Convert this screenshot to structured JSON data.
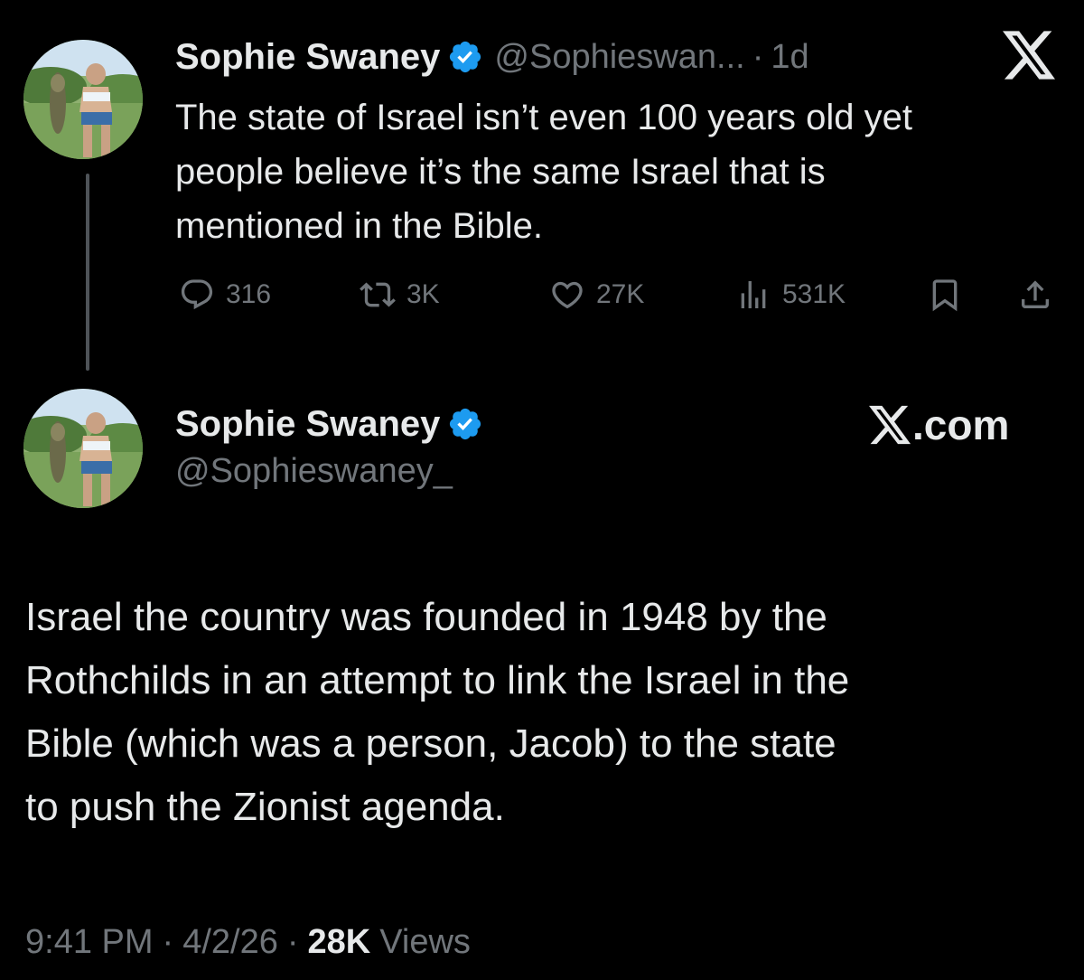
{
  "reply": {
    "author_name": "Sophie Swaney",
    "handle": "@Sophieswan...",
    "separator": "·",
    "age": "1d",
    "text_lines": [
      "The state of Israel isn’t even 100 years old yet",
      "people believe it’s the same Israel that is",
      "mentioned in the Bible."
    ],
    "actions": {
      "replies": "316",
      "reposts": "3K",
      "likes": "27K",
      "views": "531K"
    },
    "icons": [
      "verified-badge-icon",
      "x-logo-icon",
      "reply-icon",
      "repost-icon",
      "like-icon",
      "views-icon",
      "bookmark-icon",
      "share-icon"
    ]
  },
  "quoted": {
    "author_name": "Sophie Swaney",
    "handle": "@Sophieswaney_",
    "brand": ".com",
    "text_lines": [
      "Israel the country was founded in 1948 by the",
      "Rothchilds in an attempt to link the Israel in the",
      "Bible (which was a person, Jacob) to the state",
      "to push the Zionist agenda."
    ],
    "footer": {
      "time": "9:41 PM",
      "sep1": "·",
      "date": "4/2/26",
      "sep2": "·",
      "views_count": "28K",
      "views_label": "Views"
    }
  },
  "colors": {
    "background": "#000000",
    "primary_text": "#e7e9ea",
    "secondary_text": "#71767b",
    "verified_blue": "#1d9bf0",
    "thread_line": "#4e5358"
  }
}
